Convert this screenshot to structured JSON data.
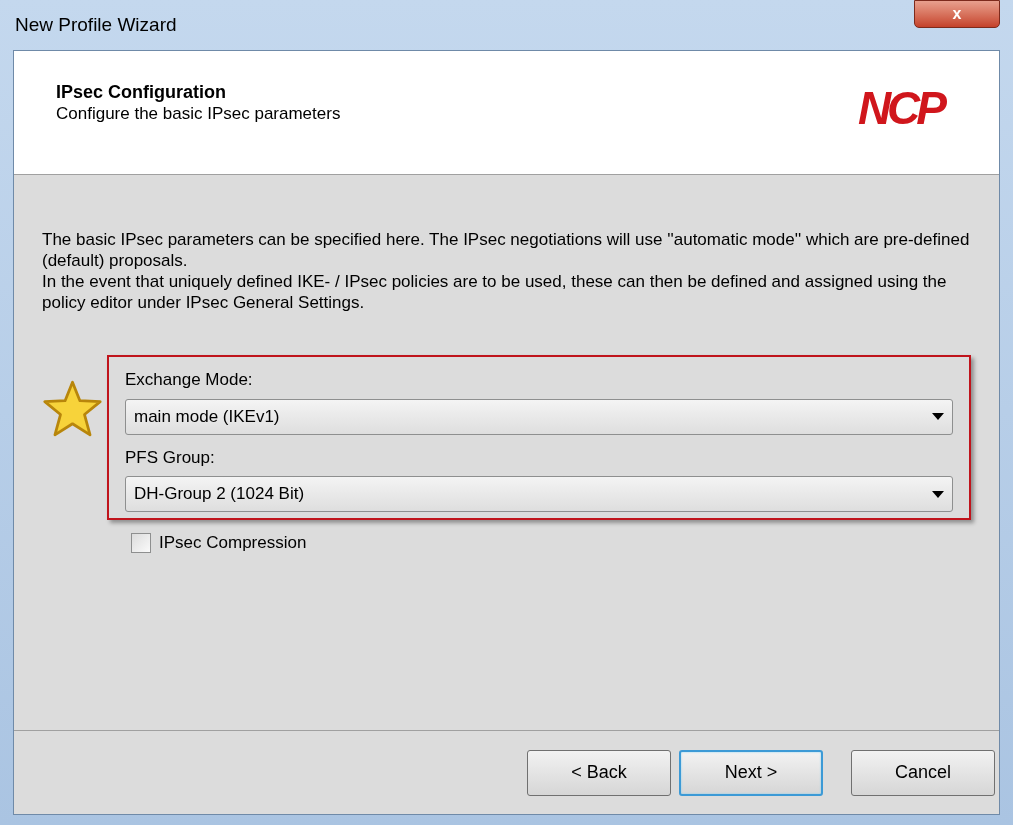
{
  "window": {
    "title": "New Profile Wizard",
    "close": "x"
  },
  "header": {
    "title": "IPsec Configuration",
    "subtitle": "Configure the basic IPsec parameters",
    "logo": "NCP"
  },
  "description": [
    "The basic IPsec parameters can be specified here. The IPsec negotiations will use ''automatic mode'' which are pre-defined (default) proposals.",
    "In the event that uniquely defined IKE- / IPsec policies are to be used, these can then be defined and assigned using the policy editor under IPsec General Settings."
  ],
  "fields": [
    {
      "label": "Exchange Mode:",
      "value": "main mode (IKEv1)"
    },
    {
      "label": "PFS Group:",
      "value": "DH-Group 2 (1024 Bit)"
    }
  ],
  "checkbox": {
    "label": "IPsec Compression",
    "checked": false
  },
  "buttons": [
    {
      "label": "< Back",
      "default": false
    },
    {
      "label": "Next >",
      "default": true
    },
    {
      "label": "Cancel",
      "default": false
    }
  ]
}
